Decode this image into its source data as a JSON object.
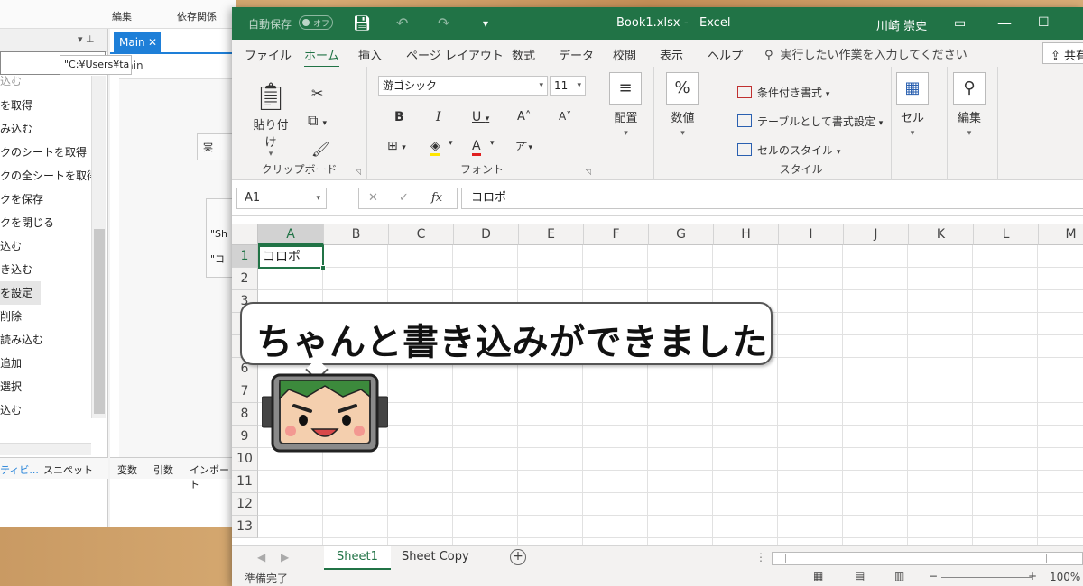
{
  "background_window": {
    "top_tabs": [
      "編集",
      "依存関係"
    ],
    "activity_items": [
      "を取得",
      "み込む",
      "クのシートを取得",
      "クの全シートを取得",
      "クを保存",
      "クを閉じる",
      "込む",
      "き込む",
      "を設定",
      "削除",
      "読み込む",
      "追加",
      "選択",
      "込む"
    ],
    "activity_first_partial": "込む",
    "bottom_tabs": [
      "ティビ...",
      "スニペット"
    ],
    "doc_tab": "Main",
    "doc_header": "Main",
    "path_value": "\"C:¥Users¥ta",
    "box_label": "実",
    "field_values": [
      "\"Sh",
      "\"コ"
    ],
    "doc_bottom_tabs": [
      "変数",
      "引数",
      "インポート"
    ]
  },
  "excel": {
    "autosave_label": "自動保存",
    "autosave_state": "オフ",
    "filename": "Book1.xlsx",
    "app_name": "Excel",
    "separator": "-",
    "user": "川崎 崇史",
    "tabs": [
      "ファイル",
      "ホーム",
      "挿入",
      "ページ レイアウト",
      "数式",
      "データ",
      "校閲",
      "表示",
      "ヘルプ"
    ],
    "active_tab": "ホーム",
    "search_placeholder": "実行したい作業を入力してください",
    "share_label": "共有",
    "ribbon": {
      "clipboard": {
        "paste_label": "貼り付け",
        "group_label": "クリップボード"
      },
      "font": {
        "font_name": "游ゴシック",
        "font_size": "11",
        "group_label": "フォント"
      },
      "alignment": {
        "label": "配置"
      },
      "number": {
        "label": "数値"
      },
      "styles": {
        "items": [
          "条件付き書式",
          "テーブルとして書式設定",
          "セルのスタイル"
        ],
        "group_label": "スタイル"
      },
      "cells": {
        "label": "セル"
      },
      "editing": {
        "label": "編集"
      }
    },
    "name_box": "A1",
    "formula_value": "コロポ",
    "columns": [
      "A",
      "B",
      "C",
      "D",
      "E",
      "F",
      "G",
      "H",
      "I",
      "J",
      "K",
      "L",
      "M"
    ],
    "rows": [
      "1",
      "2",
      "3",
      "4",
      "5",
      "6",
      "7",
      "8",
      "9",
      "10",
      "11",
      "12",
      "13"
    ],
    "cell_a1": "コロポ",
    "sheets": [
      "Sheet1",
      "Sheet Copy"
    ],
    "active_sheet": "Sheet1",
    "status": "準備完了",
    "zoom": "100%"
  },
  "callout": {
    "message": "ちゃんと書き込みができました"
  },
  "colors": {
    "excel_green": "#217346",
    "ribbon_bg": "#f3f2f1",
    "studio_blue": "#1e7fd8"
  }
}
